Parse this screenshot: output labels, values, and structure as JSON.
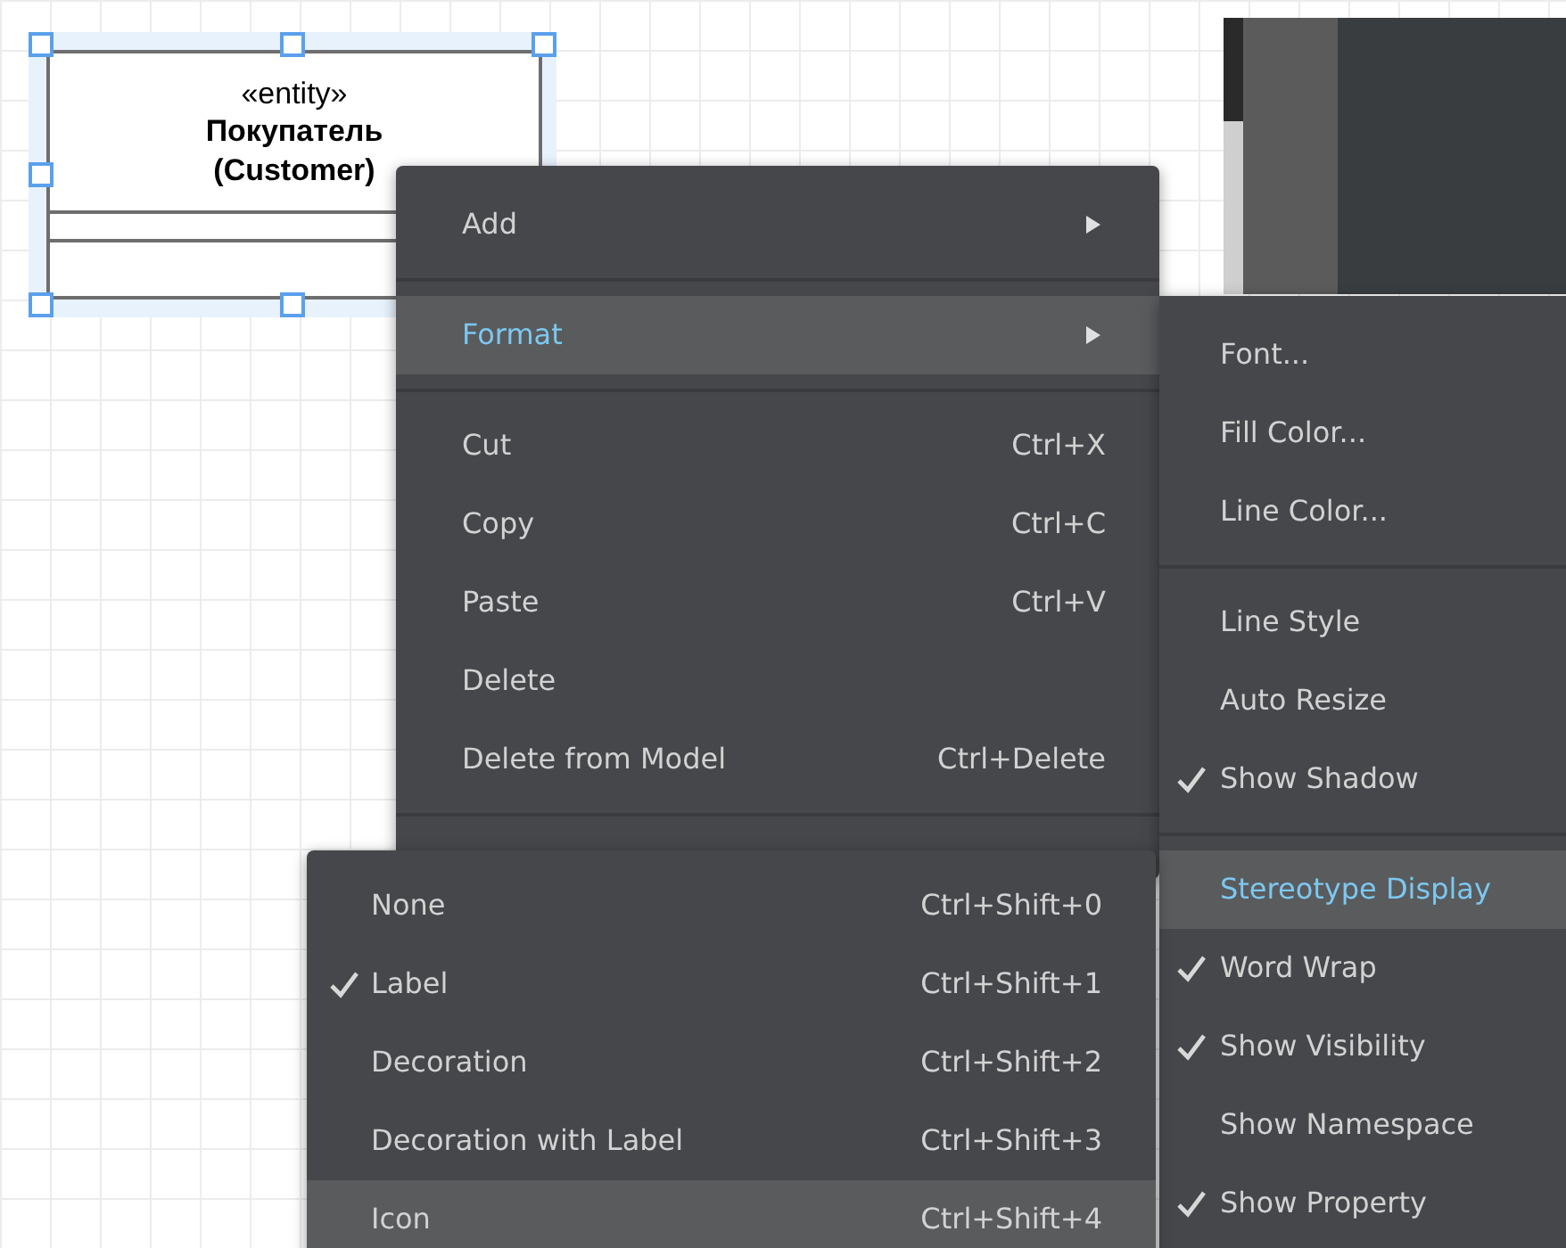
{
  "diagram": {
    "element": {
      "stereotype": "«entity»",
      "name": "Покупатель\n(Customer)",
      "selected": true
    }
  },
  "context_menu": {
    "items": [
      {
        "kind": "item",
        "label": "Add",
        "has_submenu": true,
        "selected": false
      },
      {
        "kind": "separator"
      },
      {
        "kind": "item",
        "label": "Format",
        "has_submenu": true,
        "selected": true
      },
      {
        "kind": "separator"
      },
      {
        "kind": "item",
        "label": "Cut",
        "shortcut": "Ctrl+X",
        "selected": false
      },
      {
        "kind": "item",
        "label": "Copy",
        "shortcut": "Ctrl+C",
        "selected": false
      },
      {
        "kind": "item",
        "label": "Paste",
        "shortcut": "Ctrl+V",
        "selected": false
      },
      {
        "kind": "item",
        "label": "Delete",
        "selected": false
      },
      {
        "kind": "item",
        "label": "Delete from Model",
        "shortcut": "Ctrl+Delete",
        "selected": false
      },
      {
        "kind": "separator"
      }
    ]
  },
  "format_submenu": {
    "items": [
      {
        "kind": "item",
        "label": "Font...",
        "checked": false,
        "selected": false
      },
      {
        "kind": "item",
        "label": "Fill Color...",
        "checked": false,
        "selected": false
      },
      {
        "kind": "item",
        "label": "Line Color...",
        "checked": false,
        "selected": false
      },
      {
        "kind": "separator"
      },
      {
        "kind": "item",
        "label": "Line Style",
        "checked": false,
        "selected": false
      },
      {
        "kind": "item",
        "label": "Auto Resize",
        "checked": false,
        "selected": false
      },
      {
        "kind": "item",
        "label": "Show Shadow",
        "checked": true,
        "selected": false
      },
      {
        "kind": "separator"
      },
      {
        "kind": "item",
        "label": "Stereotype Display",
        "checked": false,
        "selected": true
      },
      {
        "kind": "item",
        "label": "Word Wrap",
        "checked": true,
        "selected": false
      },
      {
        "kind": "item",
        "label": "Show Visibility",
        "checked": true,
        "selected": false
      },
      {
        "kind": "item",
        "label": "Show Namespace",
        "checked": false,
        "selected": false
      },
      {
        "kind": "item",
        "label": "Show Property",
        "checked": true,
        "selected": false
      }
    ]
  },
  "stereotype_submenu": {
    "items": [
      {
        "label": "None",
        "shortcut": "Ctrl+Shift+0",
        "checked": false,
        "selected": false
      },
      {
        "label": "Label",
        "shortcut": "Ctrl+Shift+1",
        "checked": true,
        "selected": false
      },
      {
        "label": "Decoration",
        "shortcut": "Ctrl+Shift+2",
        "checked": false,
        "selected": false
      },
      {
        "label": "Decoration with Label",
        "shortcut": "Ctrl+Shift+3",
        "checked": false,
        "selected": false
      },
      {
        "label": "Icon",
        "shortcut": "Ctrl+Shift+4",
        "checked": false,
        "selected": true
      }
    ]
  }
}
